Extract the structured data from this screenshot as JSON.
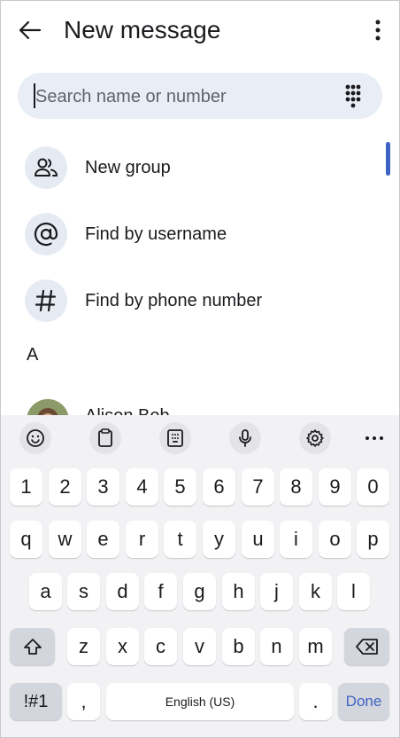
{
  "header": {
    "title": "New message"
  },
  "search": {
    "placeholder": "Search name or number"
  },
  "actions": [
    {
      "label": "New group",
      "icon": "group-icon"
    },
    {
      "label": "Find by username",
      "icon": "at-icon"
    },
    {
      "label": "Find by phone number",
      "icon": "hash-icon"
    }
  ],
  "contacts": {
    "section_letter": "A",
    "first_contact_partial_name": "Alison Bob"
  },
  "keyboard": {
    "toolbar": [
      "emoji-icon",
      "clipboard-icon",
      "keyboard-layout-icon",
      "mic-icon",
      "settings-icon",
      "more-horiz-icon"
    ],
    "row_numbers": [
      "1",
      "2",
      "3",
      "4",
      "5",
      "6",
      "7",
      "8",
      "9",
      "0"
    ],
    "row1": [
      "q",
      "w",
      "e",
      "r",
      "t",
      "y",
      "u",
      "i",
      "o",
      "p"
    ],
    "row2": [
      "a",
      "s",
      "d",
      "f",
      "g",
      "h",
      "j",
      "k",
      "l"
    ],
    "row3": [
      "z",
      "x",
      "c",
      "v",
      "b",
      "n",
      "m"
    ],
    "symbols_label": "!#1",
    "comma_label": ",",
    "space_label": "English (US)",
    "period_label": ".",
    "done_label": "Done"
  },
  "colors": {
    "accent": "#3e63c4",
    "search_bg": "#e9edf5",
    "icon_circle_bg": "#e6ebf3",
    "keyboard_bg": "#f2f2f5"
  }
}
